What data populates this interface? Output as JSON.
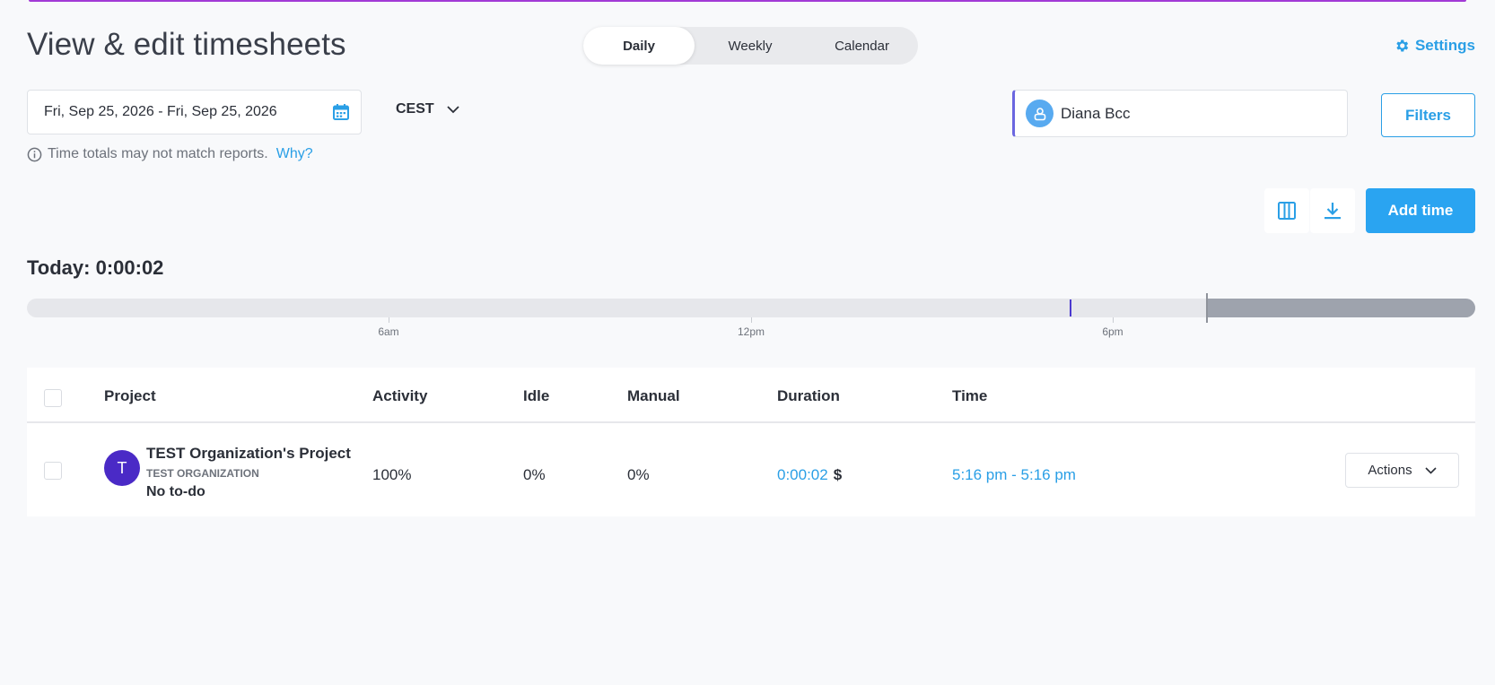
{
  "page": {
    "title": "View & edit timesheets",
    "accent_color": "#2a9fe6"
  },
  "view_switch": {
    "tabs": [
      {
        "label": "Daily",
        "active": true
      },
      {
        "label": "Weekly",
        "active": false
      },
      {
        "label": "Calendar",
        "active": false
      }
    ]
  },
  "header": {
    "settings_label": "Settings",
    "settings_icon": "gear-icon"
  },
  "filters_bar": {
    "date_range": "Fri, Sep 25, 2026 - Fri, Sep 25, 2026",
    "date_icon": "calendar-icon",
    "timezone": "CEST",
    "user": "Diana Bcc",
    "filters_label": "Filters"
  },
  "note": {
    "text": "Time totals may not match reports.",
    "link": "Why?"
  },
  "toolbar": {
    "columns_icon": "columns-icon",
    "download_icon": "download-icon",
    "add_time_label": "Add time"
  },
  "timeline": {
    "today_label": "Today: 0:00:02",
    "ticks": [
      "6am",
      "12pm",
      "6pm"
    ],
    "current_time_fraction": 0.815,
    "entry_fraction": 0.72
  },
  "table": {
    "columns": [
      "Project",
      "Activity",
      "Idle",
      "Manual",
      "Duration",
      "Time"
    ],
    "rows": [
      {
        "avatar_letter": "T",
        "project": "TEST Organization's Project",
        "organization": "TEST ORGANIZATION",
        "todo": "No to-do",
        "activity": "100%",
        "idle": "0%",
        "manual": "0%",
        "duration": "0:00:02",
        "billable_symbol": "$",
        "time": "5:16 pm - 5:16 pm",
        "actions_label": "Actions"
      }
    ]
  }
}
